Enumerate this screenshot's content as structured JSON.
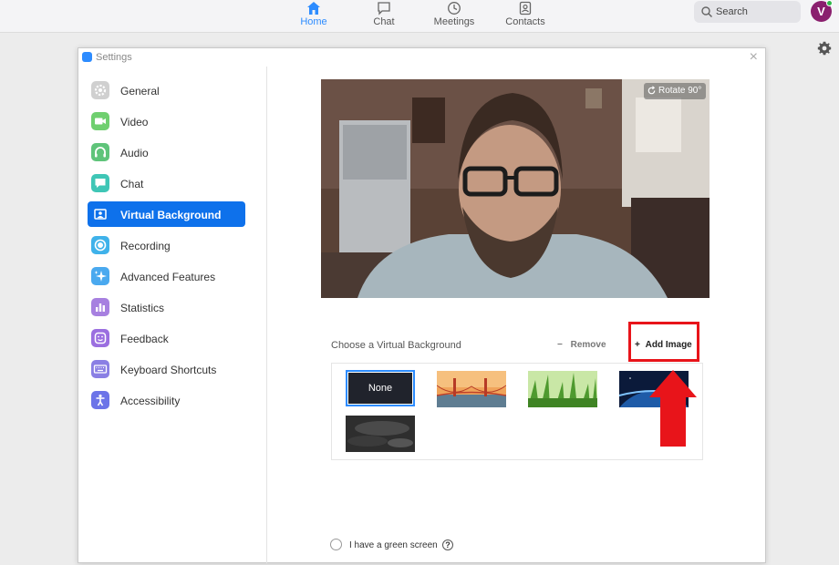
{
  "topnav": {
    "items": [
      {
        "label": "Home",
        "icon": "home-icon",
        "active": true
      },
      {
        "label": "Chat",
        "icon": "chat-icon",
        "active": false
      },
      {
        "label": "Meetings",
        "icon": "clock-icon",
        "active": false
      },
      {
        "label": "Contacts",
        "icon": "contact-icon",
        "active": false
      }
    ],
    "search_placeholder": "Search",
    "avatar_letter": "V",
    "accent": "#2d8cff"
  },
  "window": {
    "title": "Settings",
    "close_glyph": "×"
  },
  "sidebar": {
    "items": [
      {
        "label": "General",
        "icon": "gear-icon",
        "color": "#c8c8c8"
      },
      {
        "label": "Video",
        "icon": "video-icon",
        "color": "#6fcf6f"
      },
      {
        "label": "Audio",
        "icon": "headphones-icon",
        "color": "#5fc47a"
      },
      {
        "label": "Chat",
        "icon": "chat-bubble-icon",
        "color": "#3fc6b6"
      },
      {
        "label": "Virtual Background",
        "icon": "portrait-icon",
        "color": "#0e71eb",
        "active": true
      },
      {
        "label": "Recording",
        "icon": "record-icon",
        "color": "#3fb2ea"
      },
      {
        "label": "Advanced Features",
        "icon": "sparkle-icon",
        "color": "#4aa9ef"
      },
      {
        "label": "Statistics",
        "icon": "bar-chart-icon",
        "color": "#a780e0"
      },
      {
        "label": "Feedback",
        "icon": "smiley-icon",
        "color": "#9b6fe0"
      },
      {
        "label": "Keyboard Shortcuts",
        "icon": "keyboard-icon",
        "color": "#8a7fe4"
      },
      {
        "label": "Accessibility",
        "icon": "accessibility-icon",
        "color": "#6c74e8"
      }
    ]
  },
  "content": {
    "rotate_label": "Rotate 90°",
    "choose_label": "Choose a Virtual Background",
    "remove_label": "Remove",
    "add_label": "Add Image",
    "thumbnails": [
      {
        "label": "None",
        "selected": true
      },
      {
        "label": "",
        "image": "golden-gate-bridge"
      },
      {
        "label": "",
        "image": "green-grass"
      },
      {
        "label": "",
        "image": "earth-from-space"
      },
      {
        "label": "",
        "image": "dark-texture"
      }
    ],
    "green_screen_label": "I have a green screen",
    "green_screen_checked": false,
    "help_glyph": "?",
    "highlight_color": "#e8141a"
  }
}
